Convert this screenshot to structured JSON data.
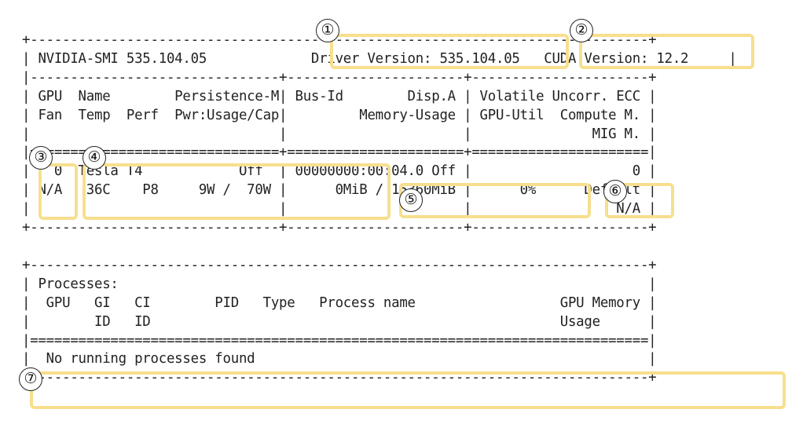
{
  "terminal_lines": [
    "+-----------------------------------------------------------------------------+",
    "| NVIDIA-SMI 535.104.05             Driver Version: 535.104.05   CUDA Version: 12.2     |",
    "|-------------------------------+----------------------+----------------------+",
    "| GPU  Name        Persistence-M| Bus-Id        Disp.A | Volatile Uncorr. ECC |",
    "| Fan  Temp  Perf  Pwr:Usage/Cap|         Memory-Usage | GPU-Util  Compute M. |",
    "|                               |                      |               MIG M. |",
    "|===============================+======================+======================|",
    "|   0  Tesla T4            Off  | 00000000:00:04.0 Off |                    0 |",
    "| N/A   36C    P8     9W /  70W |      0MiB / 15360MiB |      0%      Default |",
    "|                               |                      |                  N/A |",
    "+-------------------------------+----------------------+----------------------+",
    "",
    "+-----------------------------------------------------------------------------+",
    "| Processes:                                                                  |",
    "|  GPU   GI   CI        PID   Type   Process name                  GPU Memory |",
    "|        ID   ID                                                   Usage      |",
    "|=============================================================================|",
    "|  No running processes found                                                 |",
    "+-----------------------------------------------------------------------------+"
  ],
  "annotations": [
    "①",
    "②",
    "③",
    "④",
    "⑤",
    "⑥",
    "⑦"
  ],
  "highlight_color": "#f7df8e"
}
